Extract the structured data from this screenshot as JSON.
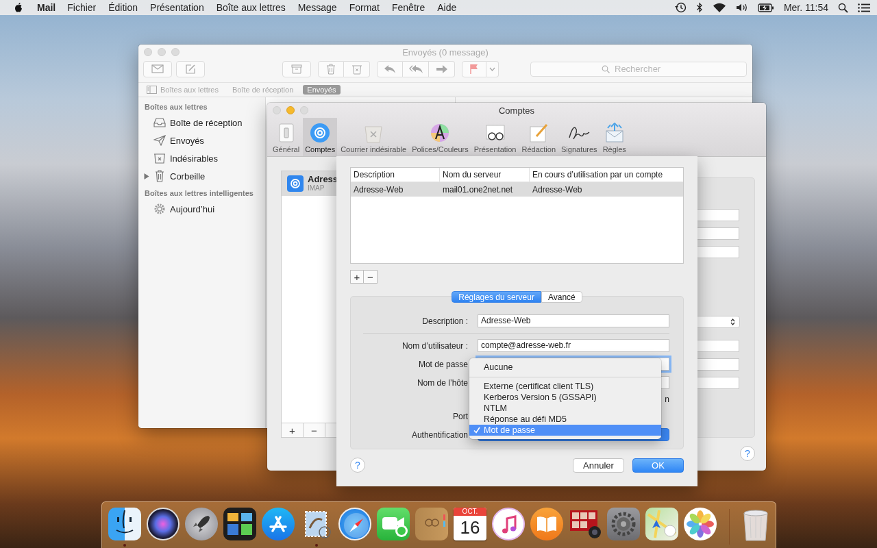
{
  "menu_bar": {
    "app_name": "Mail",
    "menus": [
      "Fichier",
      "Édition",
      "Présentation",
      "Boîte aux lettres",
      "Message",
      "Format",
      "Fenêtre",
      "Aide"
    ],
    "clock": "Mer. 11:54"
  },
  "mail_window": {
    "title": "Envoyés (0 message)",
    "search": {
      "placeholder": "Rechercher"
    },
    "favorites": [
      {
        "label": "Boîtes aux lettres",
        "selected": false,
        "kind": "sidebar"
      },
      {
        "label": "Boîte de réception",
        "selected": false,
        "kind": "plain"
      },
      {
        "label": "Envoyés",
        "selected": true,
        "kind": "plain"
      }
    ],
    "sidebar": [
      {
        "title": "Boîtes aux lettres",
        "items": [
          {
            "label": "Boîte de réception",
            "kind": "inbox",
            "disclosure": false
          },
          {
            "label": "Envoyés",
            "kind": "sent",
            "disclosure": false
          },
          {
            "label": "Indésirables",
            "kind": "junk",
            "disclosure": false
          },
          {
            "label": "Corbeille",
            "kind": "trash",
            "disclosure": true
          }
        ]
      },
      {
        "title": "Boîtes aux lettres intelligentes",
        "items": [
          {
            "label": "Aujourd’hui",
            "kind": "smart",
            "disclosure": false
          }
        ]
      }
    ]
  },
  "accounts_window": {
    "title": "Comptes",
    "tabs": [
      {
        "label": "Général",
        "kind": "general",
        "selected": false
      },
      {
        "label": "Comptes",
        "kind": "accounts",
        "selected": true
      },
      {
        "label": "Courrier indésirable",
        "kind": "junk",
        "selected": false
      },
      {
        "label": "Polices/Couleurs",
        "kind": "fonts",
        "selected": false
      },
      {
        "label": "Présentation",
        "kind": "viewing",
        "selected": false
      },
      {
        "label": "Rédaction",
        "kind": "composing",
        "selected": false
      },
      {
        "label": "Signatures",
        "kind": "signatures",
        "selected": false
      },
      {
        "label": "Règles",
        "kind": "rules",
        "selected": false
      }
    ],
    "accounts": [
      {
        "name": "Adress",
        "type": "IMAP",
        "selected": true
      }
    ],
    "list_buttons": [
      "+",
      "−"
    ],
    "help": "?"
  },
  "server_sheet": {
    "table": {
      "columns": [
        "Description",
        "Nom du serveur",
        "En cours d’utilisation par un compte"
      ],
      "rows": [
        {
          "cells": [
            "Adresse-Web",
            "mail01.one2net.net",
            "Adresse-Web"
          ],
          "selected": true
        }
      ]
    },
    "list_buttons": [
      "+",
      "−"
    ],
    "segments": [
      {
        "label": "Réglages du serveur",
        "selected": true
      },
      {
        "label": "Avancé",
        "selected": false
      }
    ],
    "form": [
      {
        "label": "Description :",
        "kind": "text",
        "value": "Adresse-Web",
        "focused": false
      },
      {
        "kind": "separator"
      },
      {
        "label": "Nom d’utilisateur :",
        "kind": "text",
        "value": "compte@adresse-web.fr",
        "focused": false
      },
      {
        "label": "Mot de passe",
        "kind": "text",
        "focused": true
      },
      {
        "label": "Nom de l’hôte",
        "kind": "text",
        "focused": false
      },
      {
        "kind": "note",
        "text": "n"
      },
      {
        "label": "Port",
        "kind": "label"
      },
      {
        "label": "Authentification",
        "kind": "popup"
      }
    ],
    "popup_menu": [
      {
        "kind": "option",
        "label": "Aucune",
        "selected": false
      },
      {
        "kind": "separator"
      },
      {
        "kind": "option",
        "label": "Externe (certificat client TLS)",
        "selected": false
      },
      {
        "kind": "option",
        "label": "Kerberos Version 5 (GSSAPI)",
        "selected": false
      },
      {
        "kind": "option",
        "label": "NTLM",
        "selected": false
      },
      {
        "kind": "option",
        "label": "Réponse au défi MD5",
        "selected": false
      },
      {
        "kind": "option",
        "label": "Mot de passe",
        "selected": true
      }
    ],
    "help": "?",
    "buttons": [
      {
        "label": "Annuler",
        "default": false
      },
      {
        "label": "OK",
        "default": true
      }
    ]
  },
  "dock": [
    {
      "kind": "finder",
      "running": true
    },
    {
      "kind": "siri",
      "running": false
    },
    {
      "kind": "launchpad",
      "running": false
    },
    {
      "kind": "mission",
      "running": false
    },
    {
      "kind": "store",
      "running": false
    },
    {
      "kind": "mail",
      "running": true
    },
    {
      "kind": "safari",
      "running": false
    },
    {
      "kind": "facetime",
      "running": false
    },
    {
      "kind": "contacts",
      "running": false
    },
    {
      "kind": "calendar",
      "running": false,
      "month": "OCT.",
      "day": "16"
    },
    {
      "kind": "music",
      "running": false
    },
    {
      "kind": "books",
      "running": false
    },
    {
      "kind": "booth",
      "running": false
    },
    {
      "kind": "prefs",
      "running": false
    },
    {
      "kind": "maps",
      "running": false
    },
    {
      "kind": "photos",
      "running": false
    },
    {
      "kind": "trash",
      "running": false
    }
  ]
}
